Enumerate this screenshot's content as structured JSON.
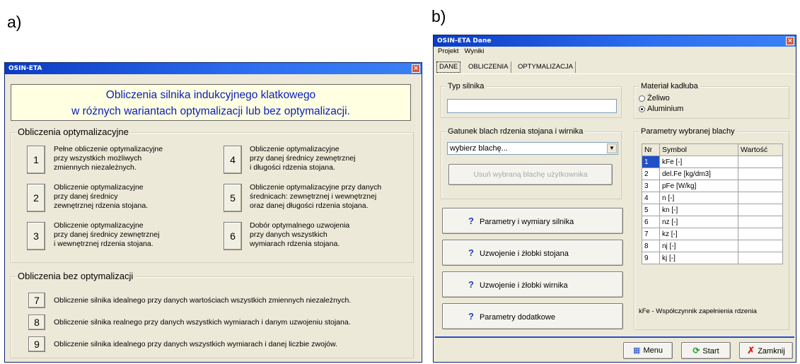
{
  "labels": {
    "a": "a)",
    "b": "b)"
  },
  "left_window": {
    "title": "OSIN-ETA",
    "close": "×",
    "banner_line1": "Obliczenia silnika indukcyjnego klatkowego",
    "banner_line2": "w różnych wariantach optymalizacji lub bez optymalizacji.",
    "group_opt_title": "Obliczenia optymalizacyjne",
    "opt_items": [
      {
        "num": "1",
        "lines": [
          "Pełne obliczenie optymalizacyjne",
          "przy wszystkich możliwych",
          "zmiennych niezależnych."
        ]
      },
      {
        "num": "2",
        "lines": [
          "Obliczenie optymalizacyjne",
          "przy danej średnicy",
          "zewnętrznej rdzenia stojana."
        ]
      },
      {
        "num": "3",
        "lines": [
          "Obliczenie optymalizacyjne",
          "przy danej średnicy zewnętrznej",
          "i wewnętrznej rdzenia stojana."
        ]
      },
      {
        "num": "4",
        "lines": [
          "Obliczenie optymalizacyjne",
          "przy danej średnicy zewnętrznej",
          "i długości rdzenia stojana."
        ]
      },
      {
        "num": "5",
        "lines": [
          "Obliczenie optymalizacyjne przy danych",
          "średnicach: zewnętrznej i wewnętrznej",
          "oraz danej długości rdzenia stojana."
        ]
      },
      {
        "num": "6",
        "lines": [
          "Dobór optymalnego uzwojenia",
          "przy danych wszystkich",
          "wymiarach rdzenia stojana."
        ]
      }
    ],
    "group_noopt_title": "Obliczenia bez optymalizacji",
    "noopt_items": [
      {
        "num": "7",
        "text": "Obliczenie silnika idealnego przy danych wartościach wszystkich zmiennych niezależnych."
      },
      {
        "num": "8",
        "text": "Obliczenie silnika realnego przy danych wszystkich wymiarach i danym uzwojeniu stojana."
      },
      {
        "num": "9",
        "text": "Obliczenie silnika idealnego przy danych wszystkich wymiarach i danej liczbie zwojów."
      }
    ]
  },
  "right_window": {
    "title": "OSIN-ETA Dane",
    "close": "×",
    "menu": [
      "Projekt",
      "Wyniki"
    ],
    "tabs": [
      "DANE",
      "OBLICZENIA",
      "OPTYMALIZACJA"
    ],
    "typ_silnika_title": "Typ silnika",
    "typ_silnika_value": "",
    "material_title": "Materiał kadłuba",
    "material_options": [
      "Żeliwo",
      "Aluminium"
    ],
    "material_selected": "Aluminium",
    "gatunek_title": "Gatunek blach rdzenia stojana i wirnika",
    "gatunek_select": "wybierz blachę...",
    "usun_button": "Usuń wybraną blachę użytkownika",
    "param_buttons": [
      "Parametry i wymiary silnika",
      "Uzwojenie i żłobki stojana",
      "Uzwojenie i żłobki wirnika",
      "Parametry dodatkowe"
    ],
    "param_blachy_title": "Parametry wybranej blachy",
    "table_headers": [
      "Nr",
      "Symbol",
      "Wartość"
    ],
    "table_rows": [
      {
        "nr": "1",
        "symbol": "kFe  [-]"
      },
      {
        "nr": "2",
        "symbol": "del.Fe [kg/dm3]"
      },
      {
        "nr": "3",
        "symbol": "pFe  [W/kg]"
      },
      {
        "nr": "4",
        "symbol": "n   [-]"
      },
      {
        "nr": "5",
        "symbol": "kn   [-]"
      },
      {
        "nr": "6",
        "symbol": "nz   [-]"
      },
      {
        "nr": "7",
        "symbol": "kz   [-]"
      },
      {
        "nr": "8",
        "symbol": "nj   [-]"
      },
      {
        "nr": "9",
        "symbol": "kj   [-]"
      }
    ],
    "kfe_note": "kFe - Współczynnik zapełnienia rdzenia",
    "bottom_buttons": {
      "menu": "Menu",
      "start": "Start",
      "zamknij": "Zamknij"
    }
  }
}
